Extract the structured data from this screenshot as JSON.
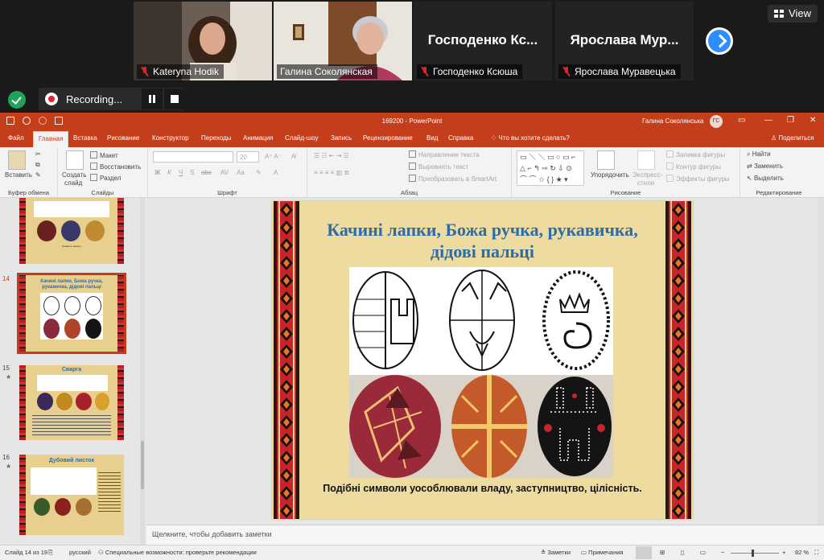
{
  "zoom": {
    "view_label": "View",
    "participants": [
      {
        "name": "Kateryna Hodik",
        "video": true
      },
      {
        "name": "Галина Соколянская",
        "video": true,
        "active": true
      },
      {
        "name": "Господенко Ксюша",
        "display": "Господенко Кс...",
        "video": false
      },
      {
        "name": "Ярослава Муравецька",
        "display": "Ярослава Мур...",
        "video": false
      }
    ],
    "recording_label": "Recording..."
  },
  "powerpoint": {
    "window_title": "169200 - PowerPoint",
    "user_name": "Галина Соколянська",
    "user_initials": "ГС",
    "tabs": [
      "Файл",
      "Главная",
      "Вставка",
      "Рисование",
      "Конструктор",
      "Переходы",
      "Анимация",
      "Слайд-шоу",
      "Запись",
      "Рецензирование",
      "Вид",
      "Справка"
    ],
    "search_placeholder": "Что вы хотите сделать?",
    "share_label": "Поделиться",
    "ribbon": {
      "paste": "Вставить",
      "new_slide_1": "Создать",
      "new_slide_2": "слайд",
      "layout": "Макет",
      "reset": "Восстановить",
      "section": "Раздел",
      "text_direction": "Направление текста",
      "align_text": "Выровнять текст",
      "smartart": "Преобразовать в SmartArt",
      "arrange": "Упорядочить",
      "quick_styles_1": "Экспресс-",
      "quick_styles_2": "стили",
      "shape_fill": "Заливка фигуры",
      "shape_outline": "Контур фигуры",
      "shape_effects": "Эффекты фигуры",
      "find": "Найти",
      "replace": "Заменить",
      "select": "Выделить",
      "font_size": "20",
      "groups": [
        "Буфер обмена",
        "Слайды",
        "Шрифт",
        "Абзац",
        "Рисование",
        "Редактирование"
      ]
    },
    "thumbnails": [
      {
        "number": "",
        "caption": "Символи захисту"
      },
      {
        "number": "14",
        "title": "Качині лапки, Божа ручка, рукавичка, дідові пальці",
        "selected": true
      },
      {
        "number": "15",
        "title": "Сварга"
      },
      {
        "number": "16",
        "title": "Дубовий листок"
      }
    ],
    "slide": {
      "title": "Качині лапки, Божа ручка, рукавичка, дідові пальці",
      "caption": "Подібні символи уособлювали владу,  заступництво, цілісність."
    },
    "notes_placeholder": "Щелкните, чтобы добавить заметки",
    "status": {
      "slide_info": "Слайд 14 из 19",
      "language": "русский",
      "accessibility": "Специальные возможности: проверьте рекомендации",
      "notes": "Заметки",
      "comments": "Примечания",
      "zoom": "82 %"
    }
  }
}
